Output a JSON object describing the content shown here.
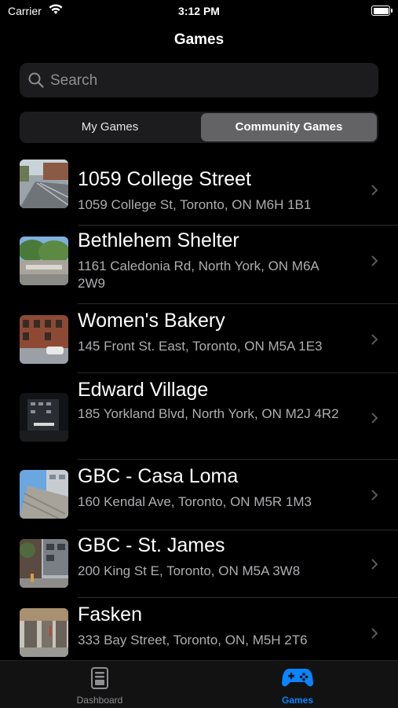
{
  "status_bar": {
    "carrier": "Carrier",
    "time": "3:12 PM"
  },
  "nav": {
    "title": "Games"
  },
  "search": {
    "placeholder": "Search",
    "value": ""
  },
  "segmented": {
    "options": [
      "My Games",
      "Community Games"
    ],
    "selected": "Community Games"
  },
  "games": [
    {
      "name": "1059 College Street",
      "address": "1059 College St, Toronto, ON M6H 1B1"
    },
    {
      "name": "Bethlehem Shelter",
      "address": "1161 Caledonia Rd, North York, ON M6A 2W9"
    },
    {
      "name": "Women's Bakery",
      "address": "145 Front St. East, Toronto, ON M5A 1E3"
    },
    {
      "name": "Edward Village",
      "address": "185 Yorkland Blvd, North York, ON M2J 4R2"
    },
    {
      "name": "GBC - Casa Loma",
      "address": "160 Kendal Ave, Toronto, ON M5R 1M3"
    },
    {
      "name": "GBC - St. James",
      "address": "200 King St E, Toronto, ON M5A 3W8"
    },
    {
      "name": "Fasken",
      "address": "333 Bay Street, Toronto, ON, M5H 2T6"
    }
  ],
  "tab_bar": {
    "items": [
      {
        "label": "Dashboard",
        "icon": "dashboard-icon"
      },
      {
        "label": "Games",
        "icon": "gamepad-icon"
      }
    ],
    "selected": "Games"
  },
  "colors": {
    "background": "#000000",
    "accent": "#0a84ff",
    "secondary_text": "#aeaeb2"
  }
}
